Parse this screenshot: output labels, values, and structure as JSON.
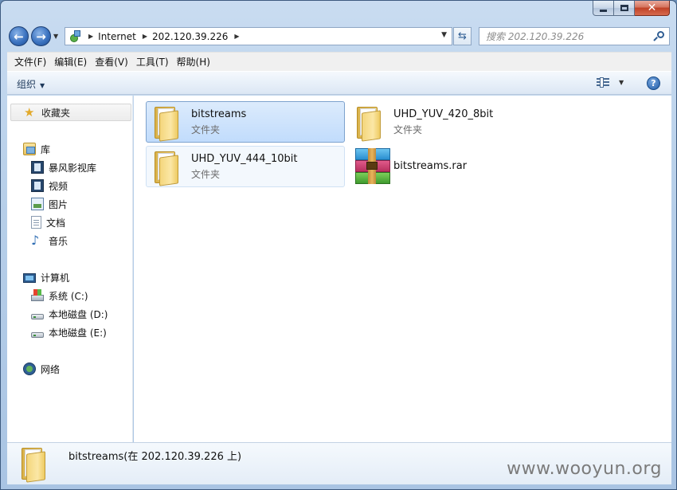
{
  "window": {
    "caption": {
      "minimize": "",
      "maximize": "",
      "close": "✕"
    }
  },
  "address_bar": {
    "back_glyph": "←",
    "forward_glyph": "→",
    "breadcrumbs": [
      "Internet",
      "202.120.39.226"
    ],
    "refresh_glyph": "⇆",
    "search_placeholder": "搜索 202.120.39.226"
  },
  "menu": [
    "文件(F)",
    "编辑(E)",
    "查看(V)",
    "工具(T)",
    "帮助(H)"
  ],
  "toolbar": {
    "organize_label": "组织",
    "help_label": "?"
  },
  "nav": {
    "favorites": "收藏夹",
    "libraries": {
      "label": "库",
      "items": [
        "暴风影视库",
        "视频",
        "图片",
        "文档",
        "音乐"
      ]
    },
    "computer": {
      "label": "计算机",
      "items": [
        "系统 (C:)",
        "本地磁盘 (D:)",
        "本地磁盘 (E:)"
      ]
    },
    "network": "网络"
  },
  "items": [
    {
      "name": "bitstreams",
      "type": "文件夹",
      "icon": "folder-icon",
      "selected": true
    },
    {
      "name": "UHD_YUV_420_8bit",
      "type": "文件夹",
      "icon": "folder-icon",
      "selected": false
    },
    {
      "name": "UHD_YUV_444_10bit",
      "type": "文件夹",
      "icon": "folder-icon",
      "selected": false
    },
    {
      "name": "bitstreams.rar",
      "type": "",
      "icon": "winrar-archive-icon",
      "selected": false
    }
  ],
  "details": {
    "text": "bitstreams(在 202.120.39.226 上)",
    "watermark": "www.wooyun.org"
  },
  "colors": {
    "selection": "#c1dcfc",
    "selection_border": "#7da2ce",
    "frame": "#b7cfe9"
  }
}
